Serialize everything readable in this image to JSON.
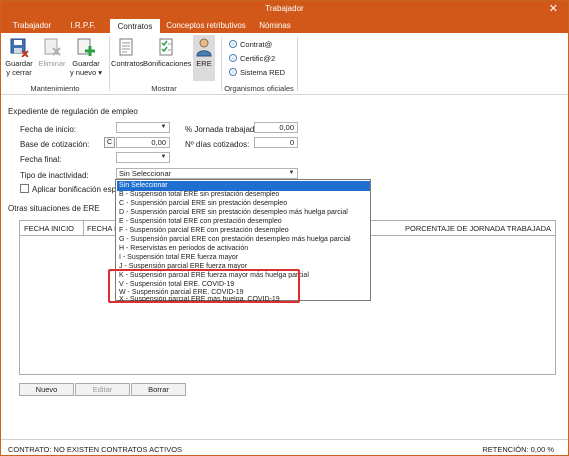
{
  "window": {
    "title": "Trabajador",
    "close_glyph": "✕"
  },
  "tabs": [
    {
      "label": "Trabajador"
    },
    {
      "label": "I.R.P.F."
    },
    {
      "label": "Contratos"
    },
    {
      "label": "Conceptos retributivos"
    },
    {
      "label": "Nóminas"
    }
  ],
  "ribbon": {
    "groups": {
      "mantenimiento": "Mantenimiento",
      "mostrar": "Mostrar",
      "organismos": "Organismos oficiales"
    },
    "buttons": {
      "guardar_cerrar": "Guardar\ny cerrar",
      "eliminar": "Eliminar",
      "guardar_nuevo": "Guardar\ny nuevo ▾",
      "contratos": "Contratos",
      "bonificaciones": "Bonificaciones",
      "ere": "ERE"
    },
    "organismos_items": [
      "Contrat@",
      "Certific@2",
      "Sistema RED"
    ]
  },
  "form": {
    "section_title": "Expediente de regulación de empleo",
    "fecha_inicio_label": "Fecha de inicio:",
    "base_cotizacion_label": "Base de cotización:",
    "base_cotizacion_btn": "C",
    "base_cotizacion_value": "0,00",
    "fecha_final_label": "Fecha final:",
    "tipo_inactividad_label": "Tipo de inactividad:",
    "tipo_inactividad_value": "Sin Seleccionar",
    "jornada_label": "% Jornada trabajada:",
    "jornada_value": "0,00",
    "dias_label": "Nº días cotizados:",
    "dias_value": "0",
    "aplicar_bonif_label": "Aplicar bonificación espe"
  },
  "dropdown_options": [
    "Sin Seleccionar",
    "B - Suspensión total ERE sin prestación desempleo",
    "C - Suspensión parcial ERE sin prestación desempleo",
    "D - Suspensión parcial ERE sin prestación desempleo más huelga parcial",
    "E - Suspensión total ERE con prestación desempleo",
    "F - Suspensión parcial ERE con prestación desempleo",
    "G - Suspensión parcial ERE con prestación desempleo más huelga parcial",
    "H - Reservistas en periodos de activación",
    "I - Suspensión total ERE fuerza mayor",
    "J - Suspensión parcial ERE fuerza mayor",
    "K - Suspensión parcial ERE fuerza mayor más huelga parcial",
    "V - Suspensión total ERE. COVID-19",
    "W - Suspensión parcial ERE. COVID-19",
    "X - Suspensión parcial ERE más huelga. COVID-19"
  ],
  "otras": {
    "title": "Otras situaciones de ERE",
    "col_fecha_inicio": "FECHA INICIO",
    "col_fecha_f": "FECHA F",
    "col_porcentaje": "PORCENTAJE DE JORNADA TRABAJADA"
  },
  "actions": {
    "nuevo": "Nuevo",
    "editar": "Editar",
    "borrar": "Borrar"
  },
  "status": {
    "contrato": "CONTRATO: NO EXISTEN CONTRATOS ACTIVOS",
    "retencion": "RETENCIÓN: 0,00 %"
  },
  "colors": {
    "accent": "#d2581a",
    "selection": "#1e6fd0",
    "highlight": "#e02d2d"
  }
}
